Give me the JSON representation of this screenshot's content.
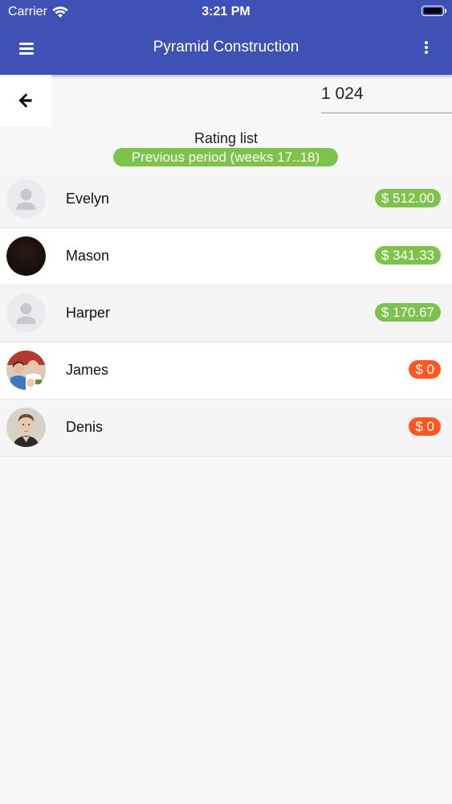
{
  "status_bar": {
    "carrier": "Carrier",
    "time": "3:21 PM"
  },
  "app_bar": {
    "title": "Pyramid Construction",
    "color": "#3f51b5"
  },
  "toolbar": {
    "amount_value": "1 024"
  },
  "heading": {
    "title": "Rating list",
    "period": "Previous period (weeks 17..18)"
  },
  "colors": {
    "positive": "#7dc24b",
    "zero": "#ff5722"
  },
  "rows": [
    {
      "name": "Evelyn",
      "amount": "$ 512.00",
      "status": "positive",
      "avatar": "placeholder-avatar"
    },
    {
      "name": "Mason",
      "amount": "$ 341.33",
      "status": "positive",
      "avatar": "dark-photo-avatar"
    },
    {
      "name": "Harper",
      "amount": "$ 170.67",
      "status": "positive",
      "avatar": "placeholder-avatar"
    },
    {
      "name": "James",
      "amount": "$ 0",
      "status": "zero",
      "avatar": "family-photo-avatar"
    },
    {
      "name": "Denis",
      "amount": "$ 0",
      "status": "zero",
      "avatar": "portrait-photo-avatar"
    }
  ]
}
